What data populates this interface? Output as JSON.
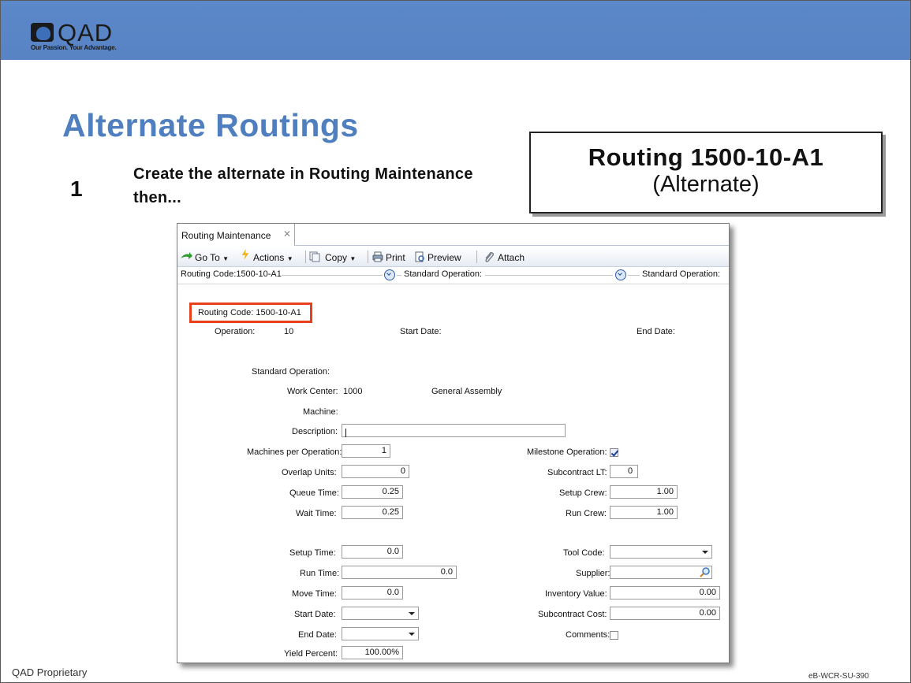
{
  "header": {
    "logo_word": "QAD",
    "logo_tagline": "Our Passion. Your Advantage."
  },
  "slide": {
    "title": "Alternate Routings",
    "step_number": "1",
    "step_text": "Create the alternate in Routing Maintenance then...",
    "callout_title": "Routing 1500-10-A1",
    "callout_subtitle": "(Alternate)"
  },
  "footer": {
    "left": "QAD Proprietary",
    "right": "eB-WCR-SU-390"
  },
  "window": {
    "tab_label": "Routing Maintenance",
    "tab_close": "✕",
    "toolbar": {
      "goto": "Go To",
      "actions": "Actions",
      "copy": "Copy",
      "print": "Print",
      "preview": "Preview",
      "attach": "Attach"
    },
    "breadcrumb": {
      "routing_code": "Routing Code:1500-10-A1",
      "std_op_1": "Standard Operation:",
      "std_op_2": "Standard Operation:"
    },
    "header_fields": {
      "routing_code": "Routing Code:  1500-10-A1",
      "operation_label": "Operation:",
      "operation_value": "10",
      "start_date_label": "Start Date:",
      "end_date_label": "End Date:"
    },
    "info": {
      "standard_operation_label": "Standard Operation:",
      "work_center_label": "Work Center:",
      "work_center_value": "1000",
      "work_center_desc": "General Assembly",
      "machine_label": "Machine:"
    },
    "form_left": {
      "description_label": "Description:",
      "description_value": "",
      "machines_per_op_label": "Machines per Operation:",
      "machines_per_op_value": "1",
      "overlap_units_label": "Overlap Units:",
      "overlap_units_value": "0",
      "queue_time_label": "Queue Time:",
      "queue_time_value": "0.25",
      "wait_time_label": "Wait Time:",
      "wait_time_value": "0.25",
      "setup_time_label": "Setup Time:",
      "setup_time_value": "0.0",
      "run_time_label": "Run Time:",
      "run_time_value": "0.0",
      "move_time_label": "Move Time:",
      "move_time_value": "0.0",
      "start_date_label": "Start Date:",
      "start_date_value": "",
      "end_date_label": "End Date:",
      "end_date_value": "",
      "yield_percent_label": "Yield Percent:",
      "yield_percent_value": "100.00%"
    },
    "form_right": {
      "milestone_label": "Milestone Operation:",
      "milestone_checked": true,
      "subcontract_lt_label": "Subcontract LT:",
      "subcontract_lt_value": "0",
      "setup_crew_label": "Setup Crew:",
      "setup_crew_value": "1.00",
      "run_crew_label": "Run Crew:",
      "run_crew_value": "1.00",
      "tool_code_label": "Tool Code:",
      "tool_code_value": "",
      "supplier_label": "Supplier:",
      "supplier_value": "",
      "inventory_value_label": "Inventory Value:",
      "inventory_value_value": "0.00",
      "subcontract_cost_label": "Subcontract Cost:",
      "subcontract_cost_value": "0.00",
      "comments_label": "Comments:",
      "comments_checked": false
    },
    "colors": {
      "highlight": "#e8401b",
      "title_blue": "#4f7fbf",
      "banner": "#5b88c9"
    }
  }
}
